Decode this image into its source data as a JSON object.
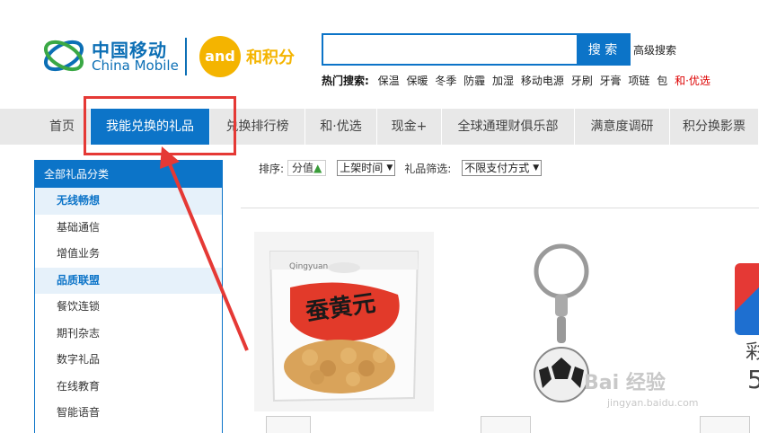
{
  "header": {
    "logo_cn": "中国移动",
    "logo_en": "China Mobile",
    "hejifen_mark": "and",
    "hejifen_text": "和积分"
  },
  "search": {
    "placeholder": "",
    "button": "搜 索",
    "advanced": "高级搜索",
    "hot_label": "热门搜索:",
    "hot_items": [
      "保温",
      "保暖",
      "冬季",
      "防霾",
      "加湿",
      "移动电源",
      "牙刷",
      "牙膏",
      "项链",
      "包"
    ],
    "hot_special": "和·优选"
  },
  "nav": {
    "items": [
      "首页",
      "我能兑换的礼品",
      "兑换排行榜",
      "和·优选",
      "现金+",
      "全球通理财俱乐部",
      "满意度调研",
      "积分换影票"
    ]
  },
  "sidebar": {
    "head": "全部礼品分类",
    "items": [
      {
        "label": "无线畅想",
        "group": true
      },
      {
        "label": "基础通信",
        "group": false
      },
      {
        "label": "增值业务",
        "group": false
      },
      {
        "label": "品质联盟",
        "group": true
      },
      {
        "label": "餐饮连锁",
        "group": false
      },
      {
        "label": "期刊杂志",
        "group": false
      },
      {
        "label": "数字礼品",
        "group": false
      },
      {
        "label": "在线教育",
        "group": false
      },
      {
        "label": "智能语音",
        "group": false
      }
    ]
  },
  "filter": {
    "sort_label": "排序:",
    "sort_value": "分值",
    "time_select": "上架时间",
    "gift_filter_label": "礼品筛选:",
    "payment_select": "不限支付方式"
  },
  "products": {
    "p1_brand": "Qingyuan",
    "p1_name": "蚕黄元",
    "p3_text1": "彩",
    "p3_text2": "5"
  },
  "watermark": {
    "main": "Bai 经验",
    "sub": "jingyan.baidu.com"
  },
  "colors": {
    "brand_blue": "#0c74c8",
    "highlight_red": "#e53935",
    "hejifen_yellow": "#f4b400"
  }
}
